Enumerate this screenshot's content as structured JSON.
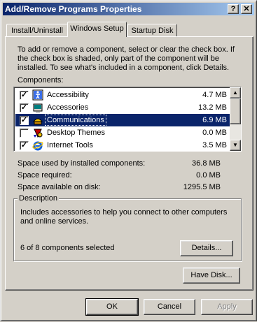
{
  "window": {
    "title": "Add/Remove Programs Properties",
    "help_glyph": "?",
    "close_glyph": "✕"
  },
  "tabs": [
    {
      "label": "Install/Uninstall",
      "active": false
    },
    {
      "label": "Windows Setup",
      "active": true
    },
    {
      "label": "Startup Disk",
      "active": false
    }
  ],
  "setup": {
    "instructions_line1": "To add or remove a component, select or clear the check box. If",
    "instructions_line2": "the check box is shaded, only part of the component will be",
    "instructions_line3": "installed. To see what's included in a component, click Details.",
    "components_label": "Components:",
    "components": [
      {
        "name": "Accessibility",
        "size": "4.7 MB",
        "checked": true,
        "selected": false,
        "icon": "accessibility-icon"
      },
      {
        "name": "Accessories",
        "size": "13.2 MB",
        "checked": true,
        "selected": false,
        "icon": "accessories-icon"
      },
      {
        "name": "Communications",
        "size": "6.9 MB",
        "checked": true,
        "selected": true,
        "icon": "communications-icon"
      },
      {
        "name": "Desktop Themes",
        "size": "0.0 MB",
        "checked": false,
        "selected": false,
        "icon": "desktop-themes-icon"
      },
      {
        "name": "Internet Tools",
        "size": "3.5 MB",
        "checked": true,
        "selected": false,
        "icon": "internet-explorer-icon"
      }
    ],
    "space_used_label": "Space used by installed components:",
    "space_used_value": "36.8 MB",
    "space_required_label": "Space required:",
    "space_required_value": "0.0 MB",
    "space_available_label": "Space available on disk:",
    "space_available_value": "1295.5 MB",
    "description_title": "Description",
    "description_line1": "Includes accessories to help you connect to other computers",
    "description_line2": "and online services.",
    "selected_count": "6 of 8 components selected",
    "details_label": "Details...",
    "have_disk_label": "Have Disk..."
  },
  "footer": {
    "ok_label": "OK",
    "cancel_label": "Cancel",
    "apply_label": "Apply"
  },
  "colors": {
    "face": "#d4d0c8",
    "title_start": "#0a246a",
    "title_end": "#a6caf0",
    "selection": "#0a246a"
  }
}
